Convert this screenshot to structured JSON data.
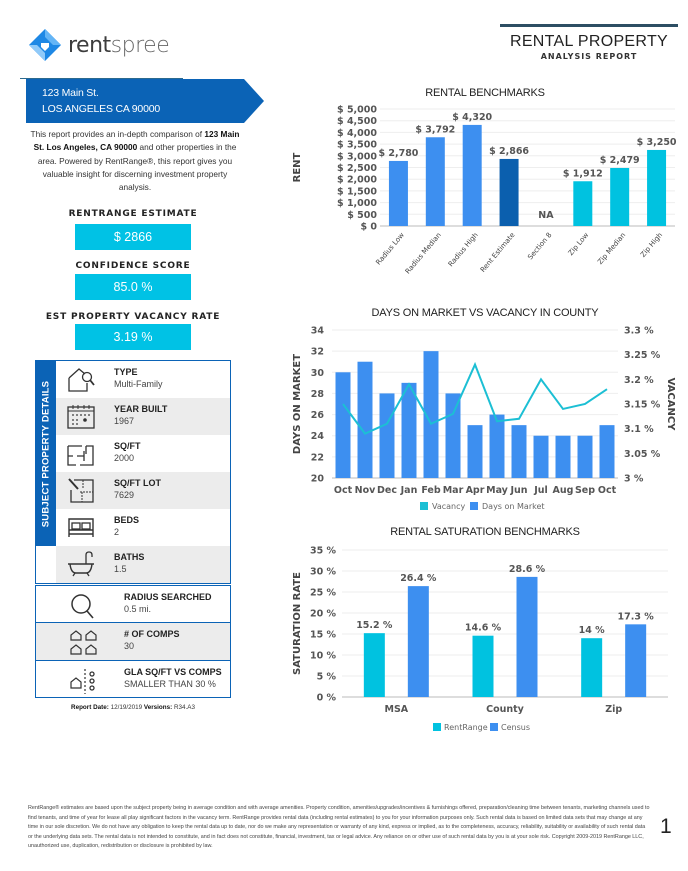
{
  "header": {
    "logo_bold": "rent",
    "logo_light": "spree",
    "title": "RENTAL PROPERTY",
    "subtitle": "ANALYSIS REPORT",
    "brand_color": "#0b63b6",
    "accent_color": "#00c2e5"
  },
  "address": {
    "line1": "123 Main St.",
    "line2": "LOS ANGELES CA 90000"
  },
  "intro": {
    "pre": "This report provides an in-depth comparison of ",
    "bold": "123 Main St. Los Angeles, CA 90000",
    "post": " and other properties in the area. Powered by RentRange®, this report gives you valuable insight for discerning investment property analysis."
  },
  "stats": [
    {
      "label": "RENTRANGE ESTIMATE",
      "value": "$ 2866"
    },
    {
      "label": "CONFIDENCE SCORE",
      "value": "85.0 %"
    },
    {
      "label": "EST PROPERTY VACANCY RATE",
      "value": "3.19 %"
    }
  ],
  "details": {
    "side_label": "SUBJECT PROPERTY DETAILS",
    "rows": [
      {
        "icon": "house-search-icon",
        "label": "TYPE",
        "value": "Multi-Family"
      },
      {
        "icon": "calendar-icon",
        "label": "YEAR BUILT",
        "value": "1967"
      },
      {
        "icon": "floorplan-icon",
        "label": "SQ/FT",
        "value": "2000"
      },
      {
        "icon": "lot-plan-icon",
        "label": "SQ/FT LOT",
        "value": "7629"
      },
      {
        "icon": "bed-icon",
        "label": "BEDS",
        "value": "2"
      },
      {
        "icon": "bathtub-icon",
        "label": "BATHS",
        "value": "1.5"
      }
    ]
  },
  "extra": [
    {
      "icon": "magnifier-icon",
      "label": "RADIUS SEARCHED",
      "value": "0.5 mi."
    },
    {
      "icon": "houses-icon",
      "label": "# OF COMPS",
      "value": "30"
    },
    {
      "icon": "house-compare-icon",
      "label": "GLA SQ/FT VS COMPS",
      "value": "SMALLER THAN 30 %"
    }
  ],
  "report_meta": {
    "date_label": "Report Date:",
    "date": "12/19/2019",
    "version_label": "Versions:",
    "version": "R34.A3"
  },
  "chart_data": [
    {
      "type": "bar",
      "title": "RENTAL BENCHMARKS",
      "xlabel": "",
      "ylabel": "RENT",
      "ylim": [
        0,
        5000
      ],
      "yticks": [
        0,
        500,
        1000,
        1500,
        2000,
        2500,
        3000,
        3500,
        4000,
        4500,
        5000
      ],
      "ytick_labels": [
        "$ 0",
        "$ 500",
        "$ 1,000",
        "$ 1,500",
        "$ 2,000",
        "$ 2,500",
        "$ 3,000",
        "$ 3,500",
        "$ 4,000",
        "$ 4,500",
        "$ 5,000"
      ],
      "categories": [
        "Radius Low",
        "Radius Median",
        "Radius High",
        "Rent Estimate",
        "Section 8",
        "Zip Low",
        "Zip Median",
        "Zip High"
      ],
      "values": [
        2780,
        3792,
        4320,
        2866,
        null,
        1912,
        2479,
        3250
      ],
      "data_labels": [
        "$ 2,780",
        "$ 3,792",
        "$ 4,320",
        "$ 2,866",
        "NA",
        "$ 1,912",
        "$ 2,479",
        "$ 3,250"
      ],
      "colors": [
        "#3d8ff0",
        "#3d8ff0",
        "#3d8ff0",
        "#0b5fae",
        "#3d8ff0",
        "#00c2e0",
        "#00c2e0",
        "#00c2e0"
      ],
      "grid": true
    },
    {
      "type": "bar",
      "title": "DAYS ON MARKET VS VACANCY IN COUNTY",
      "ylabel": "DAYS ON MARKET",
      "y2label": "VACANCY",
      "ylim": [
        20,
        34
      ],
      "yticks": [
        20,
        22,
        24,
        26,
        28,
        30,
        32,
        34
      ],
      "y2lim": [
        3.0,
        3.3
      ],
      "y2ticks": [
        3.0,
        3.05,
        3.1,
        3.15,
        3.2,
        3.25,
        3.3
      ],
      "y2tick_labels": [
        "3 %",
        "3.05 %",
        "3.1 %",
        "3.15 %",
        "3.2 %",
        "3.25 %",
        "3.3 %"
      ],
      "categories": [
        "Oct",
        "Nov",
        "Dec",
        "Jan",
        "Feb",
        "Mar",
        "Apr",
        "May",
        "Jun",
        "Jul",
        "Aug",
        "Sep",
        "Oct"
      ],
      "series": [
        {
          "name": "Days on Market",
          "type": "bar",
          "axis": "left",
          "color": "#3d8ff0",
          "values": [
            30,
            31,
            28,
            29,
            32,
            28,
            25,
            26,
            25,
            24,
            24,
            24,
            25
          ]
        },
        {
          "name": "Vacancy",
          "type": "line",
          "axis": "right",
          "color": "#1cbfd4",
          "values": [
            3.15,
            3.09,
            3.11,
            3.19,
            3.11,
            3.13,
            3.23,
            3.115,
            3.12,
            3.2,
            3.14,
            3.15,
            3.18
          ]
        }
      ],
      "legend": [
        {
          "name": "Vacancy",
          "color": "#1cbfd4"
        },
        {
          "name": "Days on Market",
          "color": "#3d8ff0"
        }
      ],
      "legend_position": "bottom",
      "grid": true
    },
    {
      "type": "bar",
      "title": "RENTAL SATURATION BENCHMARKS",
      "ylabel": "SATURATION RATE",
      "ylim": [
        0,
        35
      ],
      "yticks": [
        0,
        5,
        10,
        15,
        20,
        25,
        30,
        35
      ],
      "ytick_labels": [
        "0 %",
        "5 %",
        "10 %",
        "15 %",
        "20 %",
        "25 %",
        "30 %",
        "35 %"
      ],
      "categories": [
        "MSA",
        "County",
        "Zip"
      ],
      "series": [
        {
          "name": "RentRange",
          "color": "#00c2e0",
          "values": [
            15.2,
            14.6,
            14
          ],
          "data_labels": [
            "15.2 %",
            "14.6 %",
            "14 %"
          ]
        },
        {
          "name": "Census",
          "color": "#3d8ff0",
          "values": [
            26.4,
            28.6,
            17.3
          ],
          "data_labels": [
            "26.4 %",
            "28.6 %",
            "17.3 %"
          ]
        }
      ],
      "legend_position": "bottom",
      "grid": true
    }
  ],
  "footer": {
    "disclaimer": "RentRange® estimates are based upon the subject property being in average condition and with average amenities. Property condition, amenities/upgrades/incentives & furnishings offered, preparation/cleaning time between tenants, marketing channels used to find tenants, and time of year for lease all play significant factors in the vacancy term. RentRange provides rental data (including rental estimates) to you for your information purposes only. Such rental data is based on limited data sets that may change at any time in our sole discretion. We do not have any obligation to keep the rental data up to date, nor do we make any representation or warranty of any kind, express or implied, as to the completeness, accuracy, reliability, suitability or availability of such rental data or the underlying data sets. The rental data is not intended to constitute, and in fact does not constitute, financial, investment, tax or legal advice. Any reliance on or other use of such rental data by you is at your sole risk. Copyright 2009-2019 RentRange LLC, unauthorized use, duplication, redistribution or disclosure is prohibited by law.",
    "page_number": "1"
  }
}
